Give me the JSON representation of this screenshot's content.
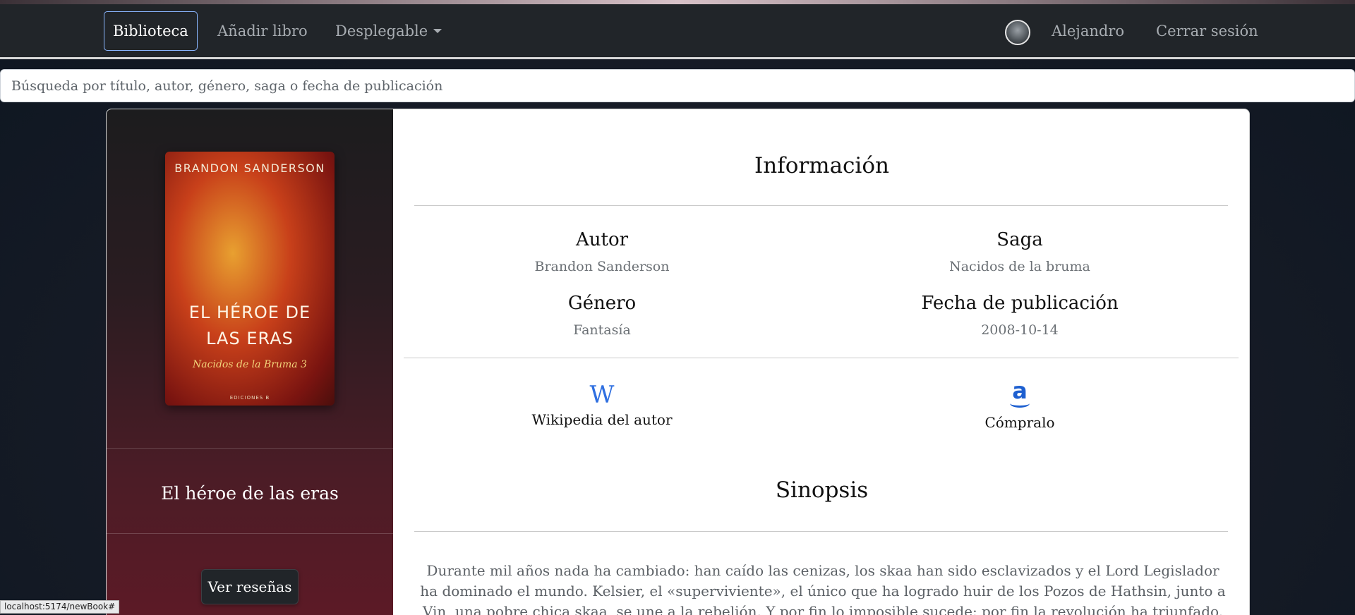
{
  "navbar": {
    "items": [
      {
        "label": "Biblioteca"
      },
      {
        "label": "Añadir libro"
      },
      {
        "label": "Desplegable"
      }
    ],
    "user_name": "Alejandro",
    "logout": "Cerrar sesión"
  },
  "search": {
    "placeholder": "Búsqueda por título, autor, género, saga o fecha de publicación"
  },
  "book": {
    "cover": {
      "author": "BRANDON SANDERSON",
      "title_line1": "EL HÉROE DE",
      "title_line2": "LAS ERAS",
      "subtitle": "Nacidos de la Bruma 3",
      "publisher": "EDICIONES B"
    },
    "title": "El héroe de las eras",
    "reviews_button": "Ver reseñas"
  },
  "info": {
    "heading": "Información",
    "author_label": "Autor",
    "author_value": "Brandon Sanderson",
    "saga_label": "Saga",
    "saga_value": "Nacidos de la bruma",
    "genre_label": "Género",
    "genre_value": "Fantasía",
    "date_label": "Fecha de publicación",
    "date_value": "2008-10-14",
    "wiki_icon": "W",
    "wiki_label": "Wikipedia del autor",
    "buy_icon": "a",
    "buy_label": "Cómpralo"
  },
  "synopsis": {
    "heading": "Sinopsis",
    "text": "Durante mil años nada ha cambiado: han caído las cenizas, los skaa han sido esclavizados y el Lord Legislador ha dominado el mundo. Kelsier, el «superviviente», el único que ha logrado huir de los Pozos de Hathsin, junto a Vin, una pobre chica skaa, se une a la rebelión. Y por fin lo imposible sucede: por fin la revolución ha triunfado. Pero acabar con el Lord Legislador es la parte"
  },
  "status_url": "localhost:5174/newBook#"
}
